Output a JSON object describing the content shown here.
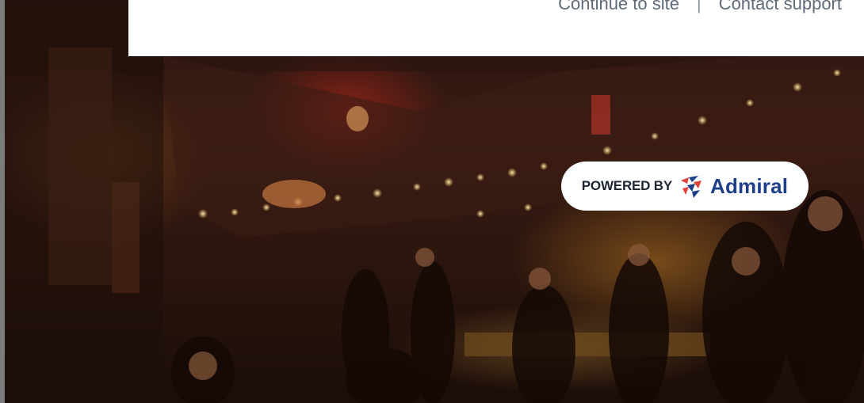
{
  "topbar": {
    "continue_label": "Continue to site",
    "separator": "|",
    "contact_label": "Contact support"
  },
  "badge": {
    "prefix": "POWERED BY",
    "brand": "Admiral",
    "logo_icon": "admiral-logo-icon"
  },
  "colors": {
    "topbar_bg": "#ffffff",
    "link_text": "#5f6b7a",
    "brand_blue": "#1d3f8a",
    "logo_red": "#e0443a"
  }
}
